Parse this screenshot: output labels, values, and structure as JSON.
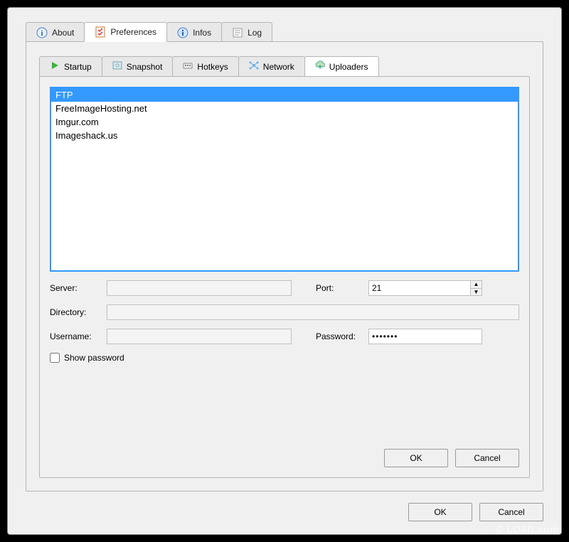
{
  "outer_tabs": {
    "about": "About",
    "preferences": "Preferences",
    "infos": "Infos",
    "log": "Log"
  },
  "inner_tabs": {
    "startup": "Startup",
    "snapshot": "Snapshot",
    "hotkeys": "Hotkeys",
    "network": "Network",
    "uploaders": "Uploaders"
  },
  "uploaders_list": {
    "item0": "FTP",
    "item1": "FreeImageHosting.net",
    "item2": "Imgur.com",
    "item3": "Imageshack.us"
  },
  "labels": {
    "server": "Server:",
    "port": "Port:",
    "directory": "Directory:",
    "username": "Username:",
    "password": "Password:",
    "show_password": "Show password"
  },
  "fields": {
    "server": "",
    "port": "21",
    "directory": "",
    "username": "",
    "password": "•••••••"
  },
  "buttons": {
    "ok": "OK",
    "cancel": "Cancel"
  },
  "watermark": "© LO4D.com"
}
